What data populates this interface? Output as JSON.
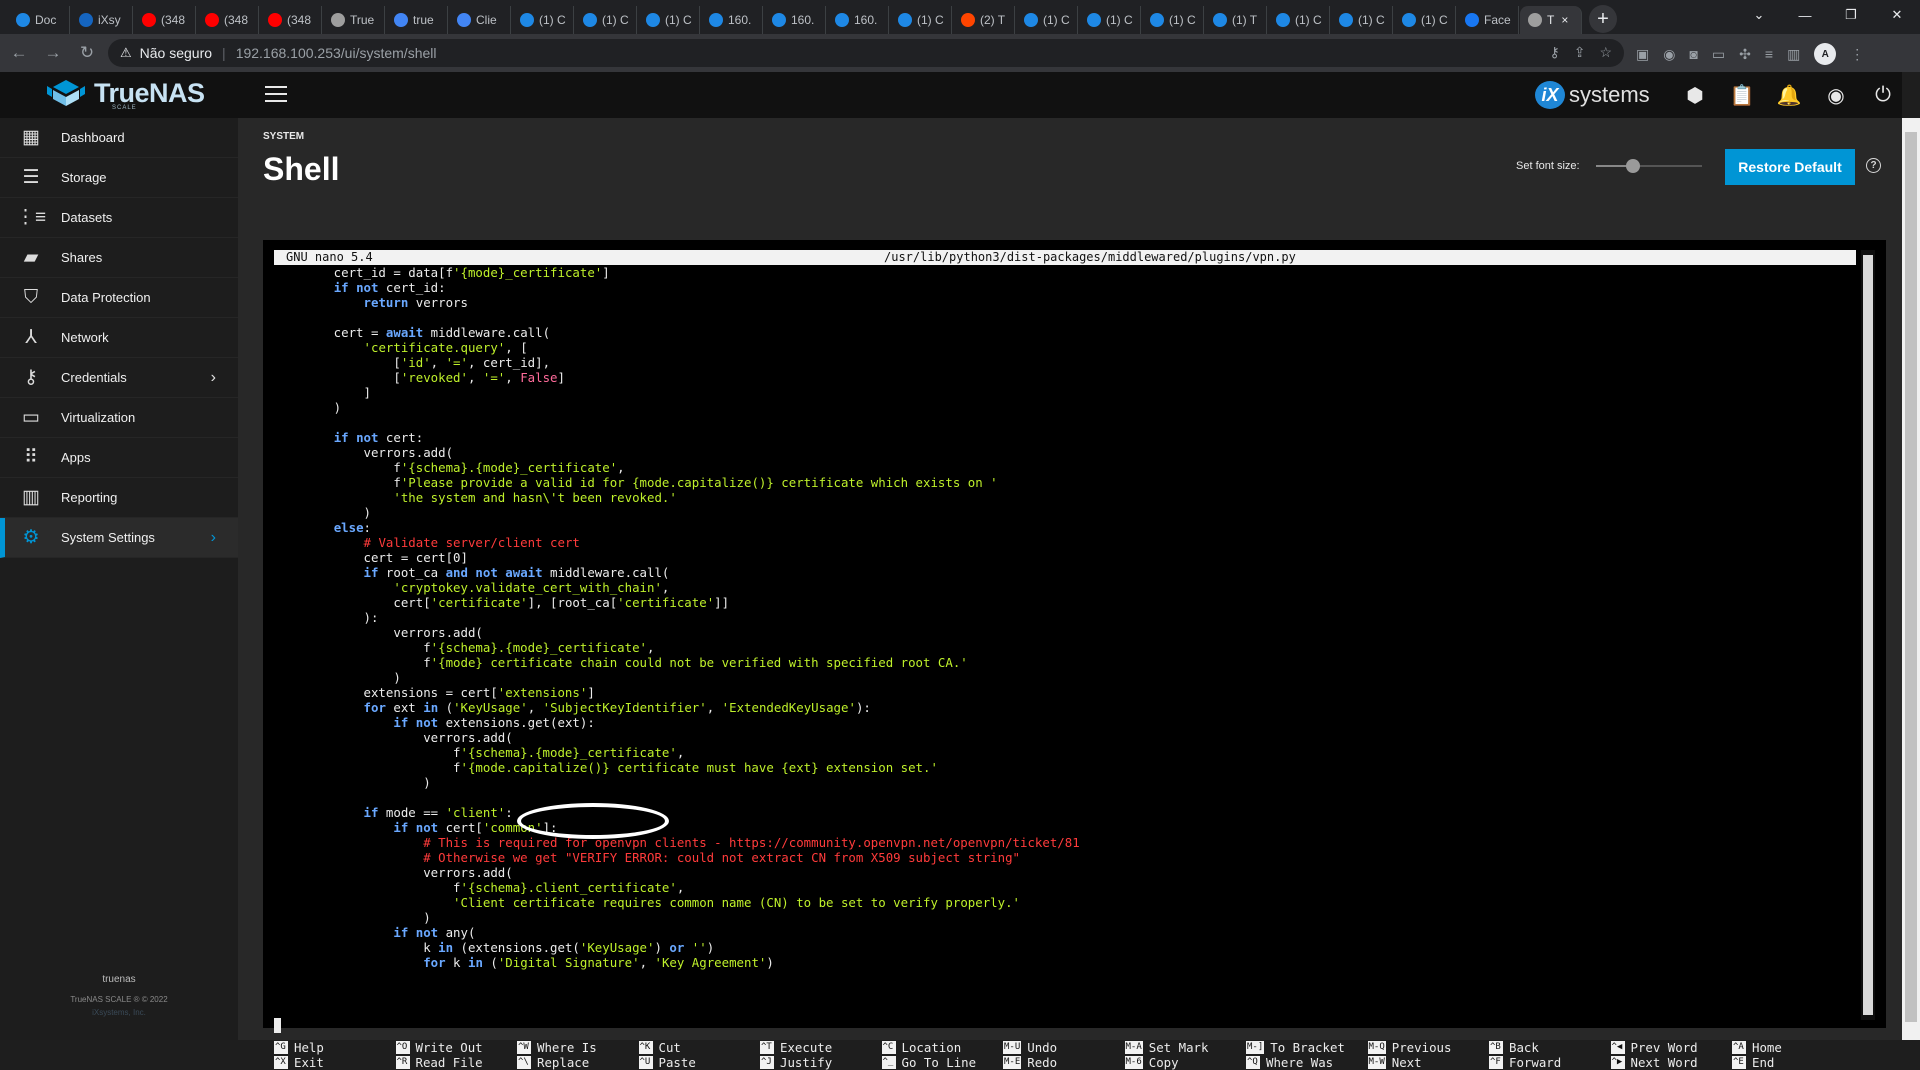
{
  "browser": {
    "tabs": [
      {
        "label": "Doc",
        "color": "#1e88e5"
      },
      {
        "label": "iXsy",
        "color": "#1565c0"
      },
      {
        "label": "(348",
        "color": "#ff0000"
      },
      {
        "label": "(348",
        "color": "#ff0000"
      },
      {
        "label": "(348",
        "color": "#ff0000"
      },
      {
        "label": "True",
        "color": "#9e9e9e"
      },
      {
        "label": "true",
        "color": "#4285f4"
      },
      {
        "label": "Clie",
        "color": "#4285f4"
      },
      {
        "label": "(1) C",
        "color": "#1e88e5"
      },
      {
        "label": "(1) C",
        "color": "#1e88e5"
      },
      {
        "label": "(1) C",
        "color": "#1e88e5"
      },
      {
        "label": "160.",
        "color": "#1e88e5"
      },
      {
        "label": "160.",
        "color": "#1e88e5"
      },
      {
        "label": "160.",
        "color": "#1e88e5"
      },
      {
        "label": "(1) C",
        "color": "#1e88e5"
      },
      {
        "label": "(2) T",
        "color": "#ff4500"
      },
      {
        "label": "(1) C",
        "color": "#1e88e5"
      },
      {
        "label": "(1) C",
        "color": "#1e88e5"
      },
      {
        "label": "(1) C",
        "color": "#1e88e5"
      },
      {
        "label": "(1) T",
        "color": "#1e88e5"
      },
      {
        "label": "(1) C",
        "color": "#1e88e5"
      },
      {
        "label": "(1) C",
        "color": "#1e88e5"
      },
      {
        "label": "(1) C",
        "color": "#1e88e5"
      },
      {
        "label": "Face",
        "color": "#1877f2"
      }
    ],
    "active_tab": {
      "label": "T",
      "close": "×"
    },
    "new_tab": "+",
    "not_secure": "Não seguro",
    "url": "192.168.100.253/ui/system/shell",
    "profile_initial": "A"
  },
  "app": {
    "logo_text": "TrueNAS",
    "logo_sub": "SCALE",
    "vendor_badge": "iX",
    "vendor_text": "systems"
  },
  "sidebar": {
    "items": [
      {
        "label": "Dashboard",
        "icon": "dashboard-icon"
      },
      {
        "label": "Storage",
        "icon": "storage-icon"
      },
      {
        "label": "Datasets",
        "icon": "datasets-icon"
      },
      {
        "label": "Shares",
        "icon": "folder-shared-icon"
      },
      {
        "label": "Data Protection",
        "icon": "security-icon"
      },
      {
        "label": "Network",
        "icon": "network-icon"
      },
      {
        "label": "Credentials",
        "icon": "key-icon"
      },
      {
        "label": "Virtualization",
        "icon": "computer-icon"
      },
      {
        "label": "Apps",
        "icon": "apps-icon"
      },
      {
        "label": "Reporting",
        "icon": "chart-icon"
      },
      {
        "label": "System Settings",
        "icon": "settings-icon"
      }
    ],
    "hostname": "truenas",
    "copyright": "TrueNAS SCALE ® © 2022",
    "vendor": "iXsystems, Inc."
  },
  "page": {
    "breadcrumb": "SYSTEM",
    "title": "Shell",
    "font_size_label": "Set font size:",
    "font_size_level": 0.35,
    "restore_label": "Restore Default",
    "help": "?"
  },
  "terminal": {
    "nano_version": "GNU nano 5.4",
    "file_path": "/usr/lib/python3/dist-packages/middlewared/plugins/vpn.py",
    "lines": [
      [
        [
          "        cert_id = data[f",
          ""
        ],
        [
          "'{mode}_certificate'",
          "str"
        ],
        [
          "]",
          ""
        ]
      ],
      [
        [
          "        ",
          ""
        ],
        [
          "if not",
          "kw"
        ],
        [
          " cert_id:",
          ""
        ]
      ],
      [
        [
          "            ",
          ""
        ],
        [
          "return",
          "kw"
        ],
        [
          " verrors",
          ""
        ]
      ],
      [
        [
          "",
          ""
        ]
      ],
      [
        [
          "        cert = ",
          ""
        ],
        [
          "await",
          "kw"
        ],
        [
          " middleware.call(",
          ""
        ]
      ],
      [
        [
          "            ",
          ""
        ],
        [
          "'certificate.query'",
          "str"
        ],
        [
          ", [",
          ""
        ]
      ],
      [
        [
          "                [",
          ""
        ],
        [
          "'id'",
          "str"
        ],
        [
          ", ",
          ""
        ],
        [
          "'='",
          "str"
        ],
        [
          ", cert_id],",
          ""
        ]
      ],
      [
        [
          "                [",
          ""
        ],
        [
          "'revoked'",
          "str"
        ],
        [
          ", ",
          ""
        ],
        [
          "'='",
          "str"
        ],
        [
          ", ",
          ""
        ],
        [
          "False",
          "const"
        ],
        [
          "]",
          ""
        ]
      ],
      [
        [
          "            ]",
          ""
        ]
      ],
      [
        [
          "        )",
          ""
        ]
      ],
      [
        [
          "",
          ""
        ]
      ],
      [
        [
          "        ",
          ""
        ],
        [
          "if not",
          "kw"
        ],
        [
          " cert:",
          ""
        ]
      ],
      [
        [
          "            verrors.add(",
          ""
        ]
      ],
      [
        [
          "                f",
          ""
        ],
        [
          "'{schema}.{mode}_certificate'",
          "str"
        ],
        [
          ",",
          ""
        ]
      ],
      [
        [
          "                f",
          ""
        ],
        [
          "'Please provide a valid id for {mode.capitalize()} certificate which exists on '",
          "str"
        ]
      ],
      [
        [
          "                ",
          ""
        ],
        [
          "'the system and hasn\\'t been revoked.'",
          "str"
        ]
      ],
      [
        [
          "            )",
          ""
        ]
      ],
      [
        [
          "        ",
          ""
        ],
        [
          "else",
          "kw"
        ],
        [
          ":",
          ""
        ]
      ],
      [
        [
          "            ",
          ""
        ],
        [
          "# Validate server/client cert",
          "cm"
        ]
      ],
      [
        [
          "            cert = cert[0]",
          ""
        ]
      ],
      [
        [
          "            ",
          ""
        ],
        [
          "if",
          "kw"
        ],
        [
          " root_ca ",
          ""
        ],
        [
          "and not await",
          "kw"
        ],
        [
          " middleware.call(",
          ""
        ]
      ],
      [
        [
          "                ",
          ""
        ],
        [
          "'cryptokey.validate_cert_with_chain'",
          "str"
        ],
        [
          ",",
          ""
        ]
      ],
      [
        [
          "                cert[",
          ""
        ],
        [
          "'certificate'",
          "str"
        ],
        [
          "], [root_ca[",
          ""
        ],
        [
          "'certificate'",
          "str"
        ],
        [
          "]]",
          ""
        ]
      ],
      [
        [
          "            ):",
          ""
        ]
      ],
      [
        [
          "                verrors.add(",
          ""
        ]
      ],
      [
        [
          "                    f",
          ""
        ],
        [
          "'{schema}.{mode}_certificate'",
          "str"
        ],
        [
          ",",
          ""
        ]
      ],
      [
        [
          "                    f",
          ""
        ],
        [
          "'{mode} certificate chain could not be verified with specified root CA.'",
          "str"
        ]
      ],
      [
        [
          "                )",
          ""
        ]
      ],
      [
        [
          "            extensions = cert[",
          ""
        ],
        [
          "'extensions'",
          "str"
        ],
        [
          "]",
          ""
        ]
      ],
      [
        [
          "            ",
          ""
        ],
        [
          "for",
          "kw"
        ],
        [
          " ext ",
          ""
        ],
        [
          "in",
          "kw"
        ],
        [
          " (",
          ""
        ],
        [
          "'KeyUsage'",
          "str"
        ],
        [
          ", ",
          ""
        ],
        [
          "'SubjectKeyIdentifier'",
          "str"
        ],
        [
          ", ",
          ""
        ],
        [
          "'ExtendedKeyUsage'",
          "str"
        ],
        [
          "):",
          ""
        ]
      ],
      [
        [
          "                ",
          ""
        ],
        [
          "if not",
          "kw"
        ],
        [
          " extensions.get(ext):",
          ""
        ]
      ],
      [
        [
          "                    verrors.add(",
          ""
        ]
      ],
      [
        [
          "                        f",
          ""
        ],
        [
          "'{schema}.{mode}_certificate'",
          "str"
        ],
        [
          ",",
          ""
        ]
      ],
      [
        [
          "                        f",
          ""
        ],
        [
          "'{mode.capitalize()} certificate must have {ext} extension set.'",
          "str"
        ]
      ],
      [
        [
          "                    )",
          ""
        ]
      ],
      [
        [
          "",
          ""
        ]
      ],
      [
        [
          "            ",
          ""
        ],
        [
          "if",
          "kw"
        ],
        [
          " mode == ",
          ""
        ],
        [
          "'client'",
          "str"
        ],
        [
          ":",
          ""
        ]
      ],
      [
        [
          "                ",
          ""
        ],
        [
          "if not",
          "kw"
        ],
        [
          " cert[",
          ""
        ],
        [
          "'common'",
          "str"
        ],
        [
          "]:",
          ""
        ]
      ],
      [
        [
          "                    ",
          ""
        ],
        [
          "# This is required for openvpn clients - https://community.openvpn.net/openvpn/ticket/81",
          "cm"
        ]
      ],
      [
        [
          "                    ",
          ""
        ],
        [
          "# Otherwise we get \"VERIFY ERROR: could not extract CN from X509 subject string\"",
          "cm"
        ]
      ],
      [
        [
          "                    verrors.add(",
          ""
        ]
      ],
      [
        [
          "                        f",
          ""
        ],
        [
          "'{schema}.client_certificate'",
          "str"
        ],
        [
          ",",
          ""
        ]
      ],
      [
        [
          "                        ",
          ""
        ],
        [
          "'Client certificate requires common name (CN) to be set to verify properly.'",
          "str"
        ]
      ],
      [
        [
          "                    )",
          ""
        ]
      ],
      [
        [
          "                ",
          ""
        ],
        [
          "if not",
          "kw"
        ],
        [
          " any(",
          ""
        ]
      ],
      [
        [
          "                    k ",
          ""
        ],
        [
          "in",
          "kw"
        ],
        [
          " (extensions.get(",
          ""
        ],
        [
          "'KeyUsage'",
          "str"
        ],
        [
          ") ",
          ""
        ],
        [
          "or",
          "kw"
        ],
        [
          " ",
          ""
        ],
        [
          "''",
          "str"
        ],
        [
          ")",
          ""
        ]
      ],
      [
        [
          "                    ",
          ""
        ],
        [
          "for",
          "kw"
        ],
        [
          " k ",
          ""
        ],
        [
          "in",
          "kw"
        ],
        [
          " (",
          ""
        ],
        [
          "'Digital Signature'",
          "str"
        ],
        [
          ", ",
          ""
        ],
        [
          "'Key Agreement'",
          "str"
        ],
        [
          ")",
          ""
        ]
      ]
    ],
    "shortcuts": [
      {
        "k1": "^G",
        "l1": "Help",
        "k2": "^X",
        "l2": "Exit"
      },
      {
        "k1": "^O",
        "l1": "Write Out",
        "k2": "^R",
        "l2": "Read File"
      },
      {
        "k1": "^W",
        "l1": "Where Is",
        "k2": "^\\",
        "l2": "Replace"
      },
      {
        "k1": "^K",
        "l1": "Cut",
        "k2": "^U",
        "l2": "Paste"
      },
      {
        "k1": "^T",
        "l1": "Execute",
        "k2": "^J",
        "l2": "Justify"
      },
      {
        "k1": "^C",
        "l1": "Location",
        "k2": "^_",
        "l2": "Go To Line"
      },
      {
        "k1": "M-U",
        "l1": "Undo",
        "k2": "M-E",
        "l2": "Redo"
      },
      {
        "k1": "M-A",
        "l1": "Set Mark",
        "k2": "M-6",
        "l2": "Copy"
      },
      {
        "k1": "M-]",
        "l1": "To Bracket",
        "k2": "^Q",
        "l2": "Where Was"
      },
      {
        "k1": "M-Q",
        "l1": "Previous",
        "k2": "M-W",
        "l2": "Next"
      },
      {
        "k1": "^B",
        "l1": "Back",
        "k2": "^F",
        "l2": "Forward"
      },
      {
        "k1": "^◀",
        "l1": "Prev Word",
        "k2": "^▶",
        "l2": "Next Word"
      },
      {
        "k1": "^A",
        "l1": "Home",
        "k2": "^E",
        "l2": "End"
      }
    ]
  }
}
